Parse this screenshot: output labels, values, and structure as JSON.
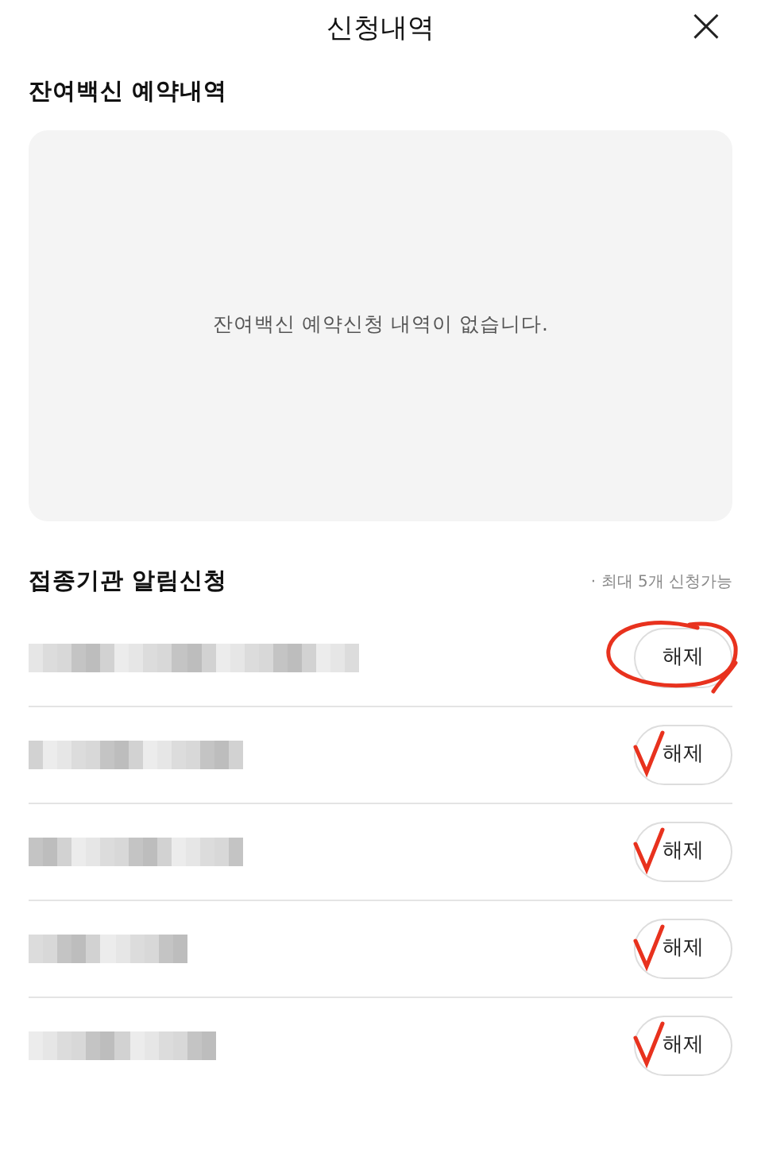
{
  "header": {
    "title": "신청내역",
    "close": "×"
  },
  "reservations": {
    "title": "잔여백신 예약내역",
    "empty_message": "잔여백신 예약신청 내역이 없습니다."
  },
  "notifications": {
    "title": "접종기관 알림신청",
    "note": "· 최대 5개 신청가능",
    "items": [
      {
        "name": {
          "kind": "blurred"
        },
        "button": "해제",
        "annotation": {
          "kind": "circle"
        }
      },
      {
        "name": {
          "kind": "blurred"
        },
        "button": "해제",
        "annotation": {
          "kind": "check"
        }
      },
      {
        "name": {
          "kind": "blurred"
        },
        "button": "해제",
        "annotation": {
          "kind": "check"
        }
      },
      {
        "name": {
          "kind": "blurred"
        },
        "button": "해제",
        "annotation": {
          "kind": "check"
        }
      },
      {
        "name": {
          "kind": "blurred"
        },
        "button": "해제",
        "annotation": {
          "kind": "check"
        }
      }
    ]
  }
}
